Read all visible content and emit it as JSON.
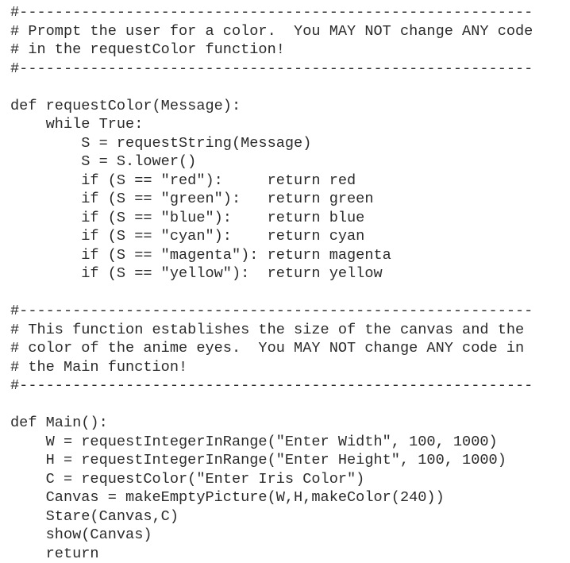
{
  "document": {
    "kind": "source-code-listing",
    "language": "python",
    "background_color": "#ffffff",
    "text_color": "#2b2b2b"
  },
  "code": {
    "lines": [
      "#----------------------------------------------------------",
      "# Prompt the user for a color.  You MAY NOT change ANY code",
      "# in the requestColor function!",
      "#----------------------------------------------------------",
      "",
      "def requestColor(Message):",
      "    while True:",
      "        S = requestString(Message)",
      "        S = S.lower()",
      "        if (S == \"red\"):     return red",
      "        if (S == \"green\"):   return green",
      "        if (S == \"blue\"):    return blue",
      "        if (S == \"cyan\"):    return cyan",
      "        if (S == \"magenta\"): return magenta",
      "        if (S == \"yellow\"):  return yellow",
      "",
      "#----------------------------------------------------------",
      "# This function establishes the size of the canvas and the",
      "# color of the anime eyes.  You MAY NOT change ANY code in",
      "# the Main function!",
      "#----------------------------------------------------------",
      "",
      "def Main():",
      "    W = requestIntegerInRange(\"Enter Width\", 100, 1000)",
      "    H = requestIntegerInRange(\"Enter Height\", 100, 1000)",
      "    C = requestColor(\"Enter Iris Color\")",
      "    Canvas = makeEmptyPicture(W,H,makeColor(240))",
      "    Stare(Canvas,C)",
      "    show(Canvas)",
      "    return"
    ]
  }
}
